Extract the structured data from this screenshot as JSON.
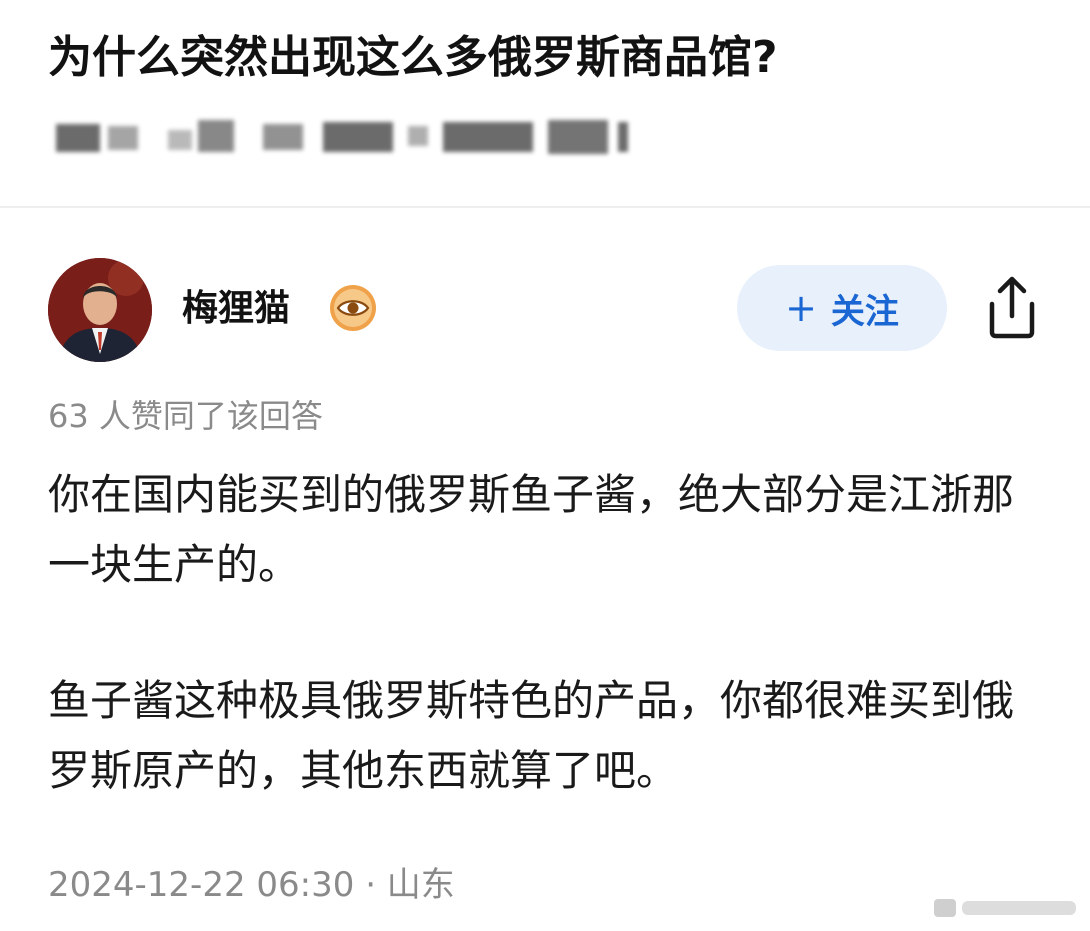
{
  "question": {
    "title": "为什么突然出现这么多俄罗斯商品馆?"
  },
  "author": {
    "name": "梅狸猫",
    "verify_icon": "eye-badge-icon"
  },
  "actions": {
    "follow_plus": "+",
    "follow_label": "关注",
    "share_icon": "share-icon"
  },
  "answer": {
    "agree_text": "63 人赞同了该回答",
    "paragraphs": [
      "你在国内能买到的俄罗斯鱼子酱，绝大部分是江浙那一块生产的。",
      "鱼子酱这种极具俄罗斯特色的产品，你都很难买到俄罗斯原产的，其他东西就算了吧。"
    ],
    "timestamp": "2024-12-22 06:30 · 山东"
  },
  "colors": {
    "accent": "#1a66d2",
    "follow_bg": "#e8f0fb",
    "muted_text": "#8a8a8a",
    "badge_orange": "#f0a24a"
  }
}
